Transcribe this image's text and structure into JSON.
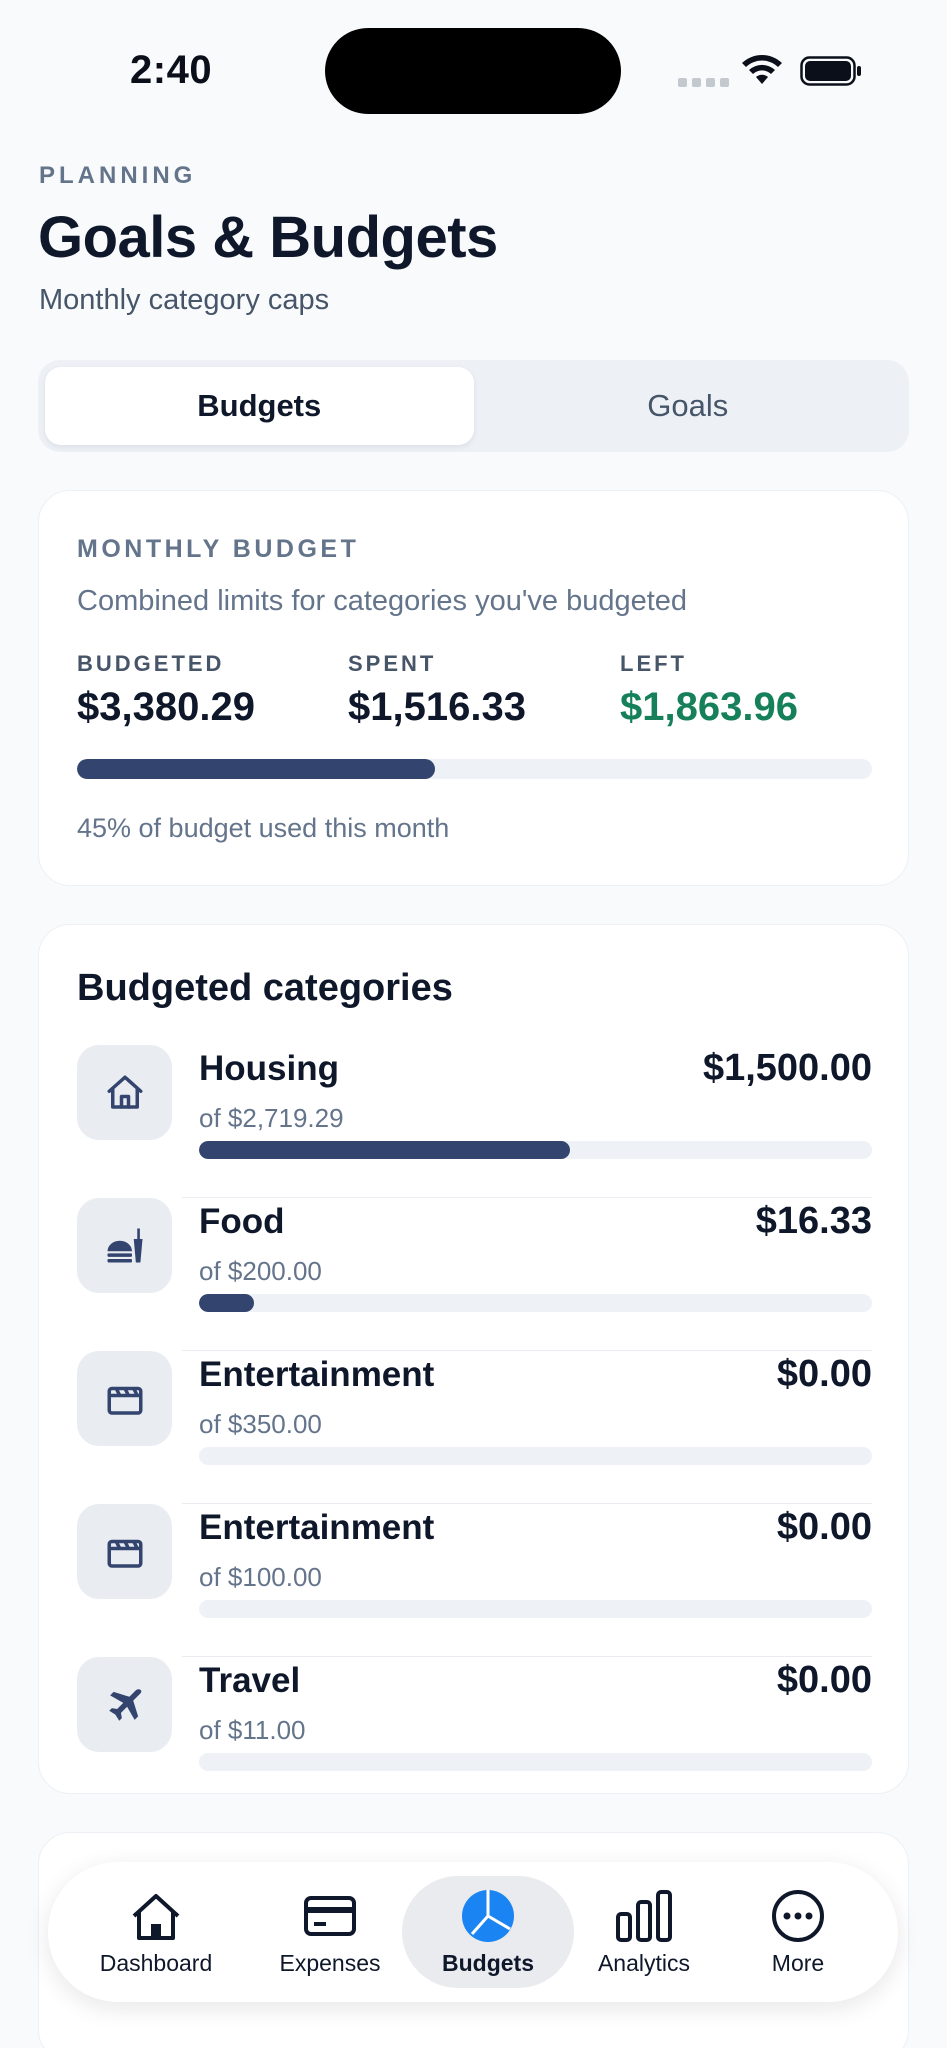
{
  "status": {
    "time": "2:40"
  },
  "header": {
    "eyebrow": "PLANNING",
    "title": "Goals & Budgets",
    "subtitle": "Monthly category caps"
  },
  "segments": {
    "budgets": "Budgets",
    "goals": "Goals",
    "selected": "Budgets"
  },
  "summary": {
    "label": "MONTHLY BUDGET",
    "description": "Combined limits for categories you've budgeted",
    "budgeted_label": "BUDGETED",
    "budgeted_value": "$3,380.29",
    "spent_label": "SPENT",
    "spent_value": "$1,516.33",
    "left_label": "LEFT",
    "left_value": "$1,863.96",
    "progress_fraction": 0.45,
    "note": "45% of budget used this month"
  },
  "categories": {
    "title": "Budgeted categories",
    "items": [
      {
        "name": "Housing",
        "limit": "of $2,719.29",
        "spent": "$1,500.00",
        "icon": "house-icon",
        "progress": 0.552
      },
      {
        "name": "Food",
        "limit": "of $200.00",
        "spent": "$16.33",
        "icon": "food-icon",
        "progress": 0.082
      },
      {
        "name": "Entertainment",
        "limit": "of $350.00",
        "spent": "$0.00",
        "icon": "clapperboard-icon",
        "progress": 0
      },
      {
        "name": "Entertainment",
        "limit": "of $100.00",
        "spent": "$0.00",
        "icon": "clapperboard-icon",
        "progress": 0
      },
      {
        "name": "Travel",
        "limit": "of $11.00",
        "spent": "$0.00",
        "icon": "airplane-icon",
        "progress": 0
      }
    ]
  },
  "tabbar": {
    "dashboard": "Dashboard",
    "expenses": "Expenses",
    "budgets": "Budgets",
    "analytics": "Analytics",
    "more": "More",
    "active": "Budgets"
  },
  "colors": {
    "accent": "#33456e",
    "positive": "#16805a",
    "active_tab_icon": "#1a84f2",
    "background": "#f8fafc"
  }
}
